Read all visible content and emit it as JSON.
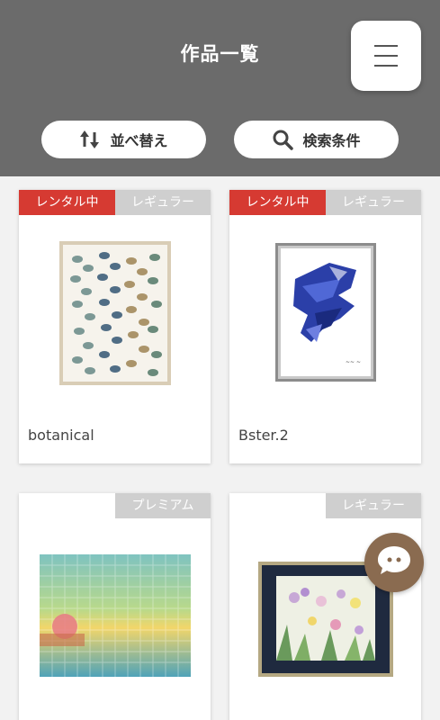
{
  "header": {
    "title": "作品一覧",
    "menu_icon": "hamburger-icon"
  },
  "toolbar": {
    "sort_label": "並べ替え",
    "sort_icon": "sort-arrows-icon",
    "search_label": "検索条件",
    "search_icon": "search-icon"
  },
  "artworks": [
    {
      "rental_badge": "レンタル中",
      "plan_badge": "レギュラー",
      "title": "botanical"
    },
    {
      "rental_badge": "レンタル中",
      "plan_badge": "レギュラー",
      "title": "Bster.2"
    },
    {
      "rental_badge": "",
      "plan_badge": "プレミアム",
      "title": ""
    },
    {
      "rental_badge": "",
      "plan_badge": "レギュラー",
      "title": ""
    }
  ],
  "chat": {
    "icon": "chat-bubble-icon"
  },
  "colors": {
    "header_bg": "#6b6b6b",
    "rental_badge": "#d63a32",
    "plan_badge": "#cfcfcf",
    "chat_button": "#8a6b50"
  }
}
